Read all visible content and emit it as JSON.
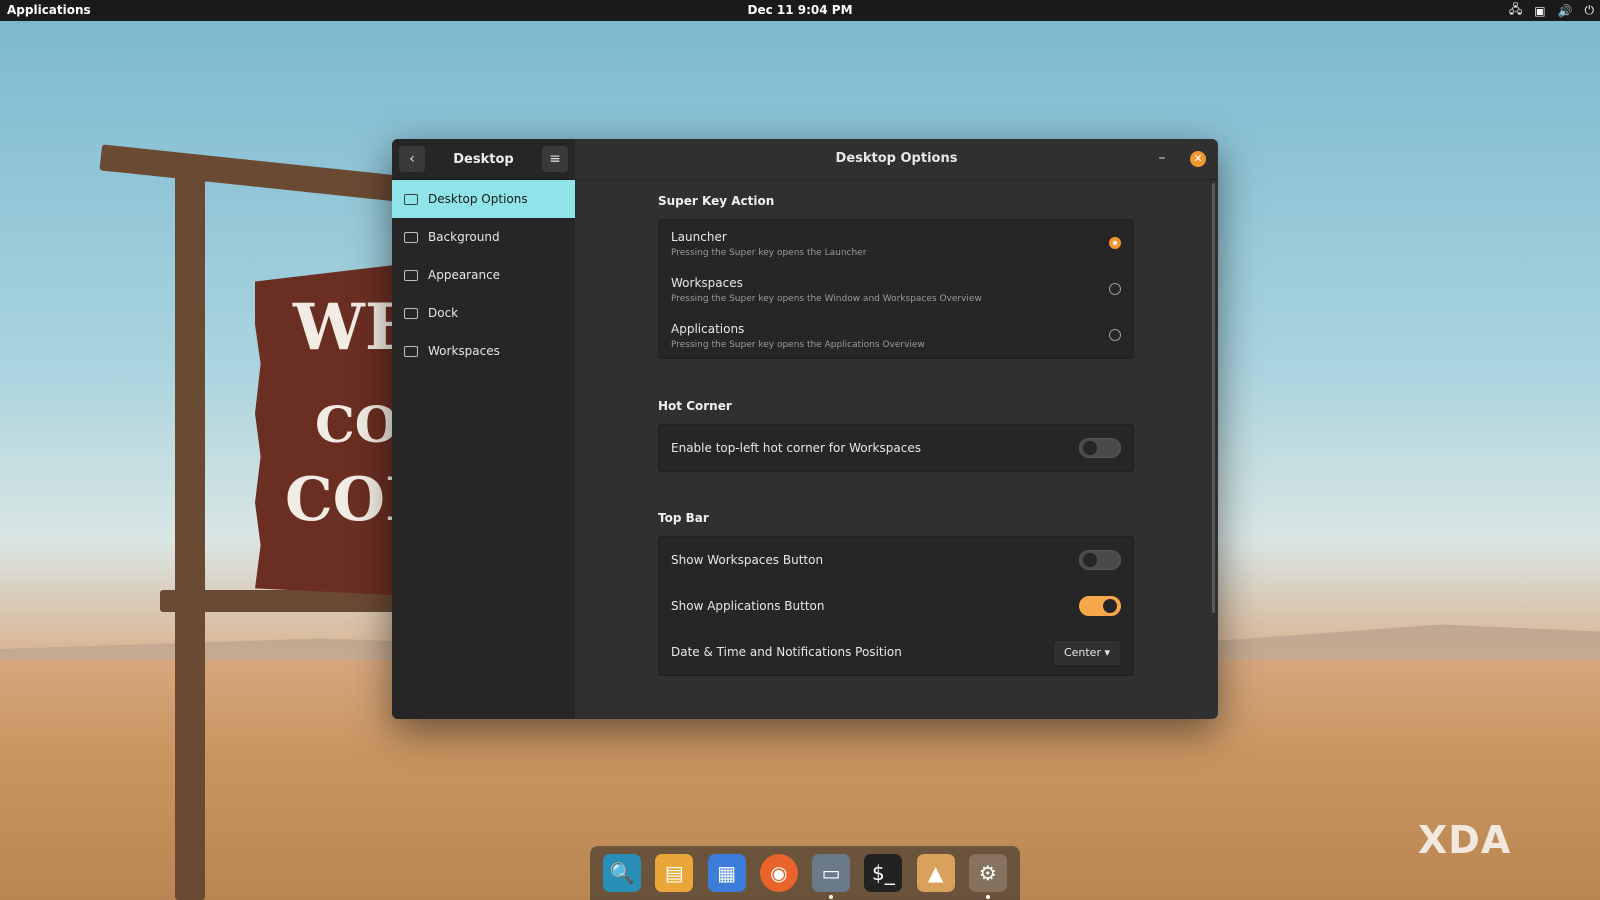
{
  "topbar": {
    "applications_label": "Applications",
    "clock": "Dec 11   9:04 PM"
  },
  "wallpaper_sign": {
    "line1": "WEL",
    "line2": "CO",
    "line3": "COL"
  },
  "sidebar": {
    "title": "Desktop",
    "items": [
      {
        "label": "Desktop Options",
        "icon": "monitor-icon",
        "active": true
      },
      {
        "label": "Background",
        "icon": "background-icon"
      },
      {
        "label": "Appearance",
        "icon": "appearance-icon"
      },
      {
        "label": "Dock",
        "icon": "dock-icon"
      },
      {
        "label": "Workspaces",
        "icon": "workspaces-icon"
      }
    ]
  },
  "main": {
    "title": "Desktop Options",
    "super_key": {
      "title": "Super Key Action",
      "options": [
        {
          "label": "Launcher",
          "desc": "Pressing the Super key opens the Launcher",
          "selected": true
        },
        {
          "label": "Workspaces",
          "desc": "Pressing the Super key opens the Window and Workspaces Overview",
          "selected": false
        },
        {
          "label": "Applications",
          "desc": "Pressing the Super key opens the Applications Overview",
          "selected": false
        }
      ]
    },
    "hot_corner": {
      "title": "Hot Corner",
      "label": "Enable top-left hot corner for Workspaces",
      "enabled": false
    },
    "top_bar": {
      "title": "Top Bar",
      "workspaces_button_label": "Show Workspaces Button",
      "workspaces_button_enabled": false,
      "applications_button_label": "Show Applications Button",
      "applications_button_enabled": true,
      "datetime_label": "Date & Time and Notifications Position",
      "datetime_value": "Center"
    }
  },
  "dock": {
    "items": [
      "search-icon",
      "files-manager-icon",
      "app-grid-icon",
      "firefox-icon",
      "file-manager-icon",
      "terminal-icon",
      "shop-icon",
      "settings-icon"
    ]
  },
  "watermark": "XDA",
  "colors": {
    "accent": "#f3962f",
    "selection": "#8ee4e8",
    "window_bg": "#303030",
    "sidebar_bg": "#262626"
  }
}
